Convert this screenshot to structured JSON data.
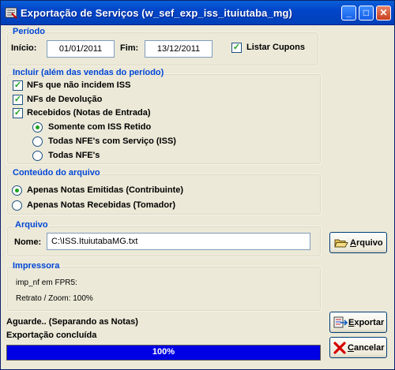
{
  "window": {
    "title": "Exportação de Serviços (w_sef_exp_iss_ituiutaba_mg)",
    "controls": {
      "minimize": "_",
      "maximize": "□",
      "close": "✕"
    }
  },
  "periodo": {
    "title": "Período",
    "inicio_label": "Início:",
    "inicio_value": "01/01/2011",
    "fim_label": "Fim:",
    "fim_value": "13/12/2011",
    "listar_cupons_label": "Listar Cupons",
    "listar_cupons_checked": true
  },
  "incluir": {
    "title": "Incluir (além das vendas do período)",
    "items": [
      {
        "label": "NFs que não incidem ISS",
        "checked": true
      },
      {
        "label": "NFs de Devolução",
        "checked": true
      },
      {
        "label": "Recebidos (Notas de Entrada)",
        "checked": true
      }
    ],
    "options": [
      {
        "label": "Somente com ISS Retido",
        "selected": true
      },
      {
        "label": "Todas NFE's com Serviço (ISS)",
        "selected": false
      },
      {
        "label": "Todas NFE's",
        "selected": false
      }
    ]
  },
  "conteudo": {
    "title": "Conteúdo do arquivo",
    "options": [
      {
        "label": "Apenas Notas Emitidas (Contribuinte)",
        "selected": true
      },
      {
        "label": "Apenas Notas Recebidas (Tomador)",
        "selected": false
      }
    ]
  },
  "arquivo": {
    "title": "Arquivo",
    "nome_label": "Nome:",
    "nome_value": "C:\\ISS.ItuiutabaMG.txt",
    "button_underlined": "A",
    "button_rest": "rquivo",
    "button_icon": "folder-open-icon"
  },
  "impressora": {
    "title": "Impressora",
    "line1": "imp_nf em FPR5:",
    "line2": "Retrato / Zoom: 100%"
  },
  "status": {
    "line1": "Aguarde.. (Separando as Notas)",
    "line2": "Exportação concluída",
    "progress_text": "100%",
    "progress_fraction": 1.0
  },
  "buttons": {
    "exportar_underlined": "E",
    "exportar_rest": "xportar",
    "exportar_icon": "export-icon",
    "cancelar_underlined": "C",
    "cancelar_rest": "ancelar",
    "cancelar_icon": "red-x-icon"
  },
  "colors": {
    "title_bar": "#0245c9",
    "group_title": "#0046d5",
    "progress": "#0000e4",
    "check": "#21a121",
    "cancel_x": "#d40000"
  }
}
